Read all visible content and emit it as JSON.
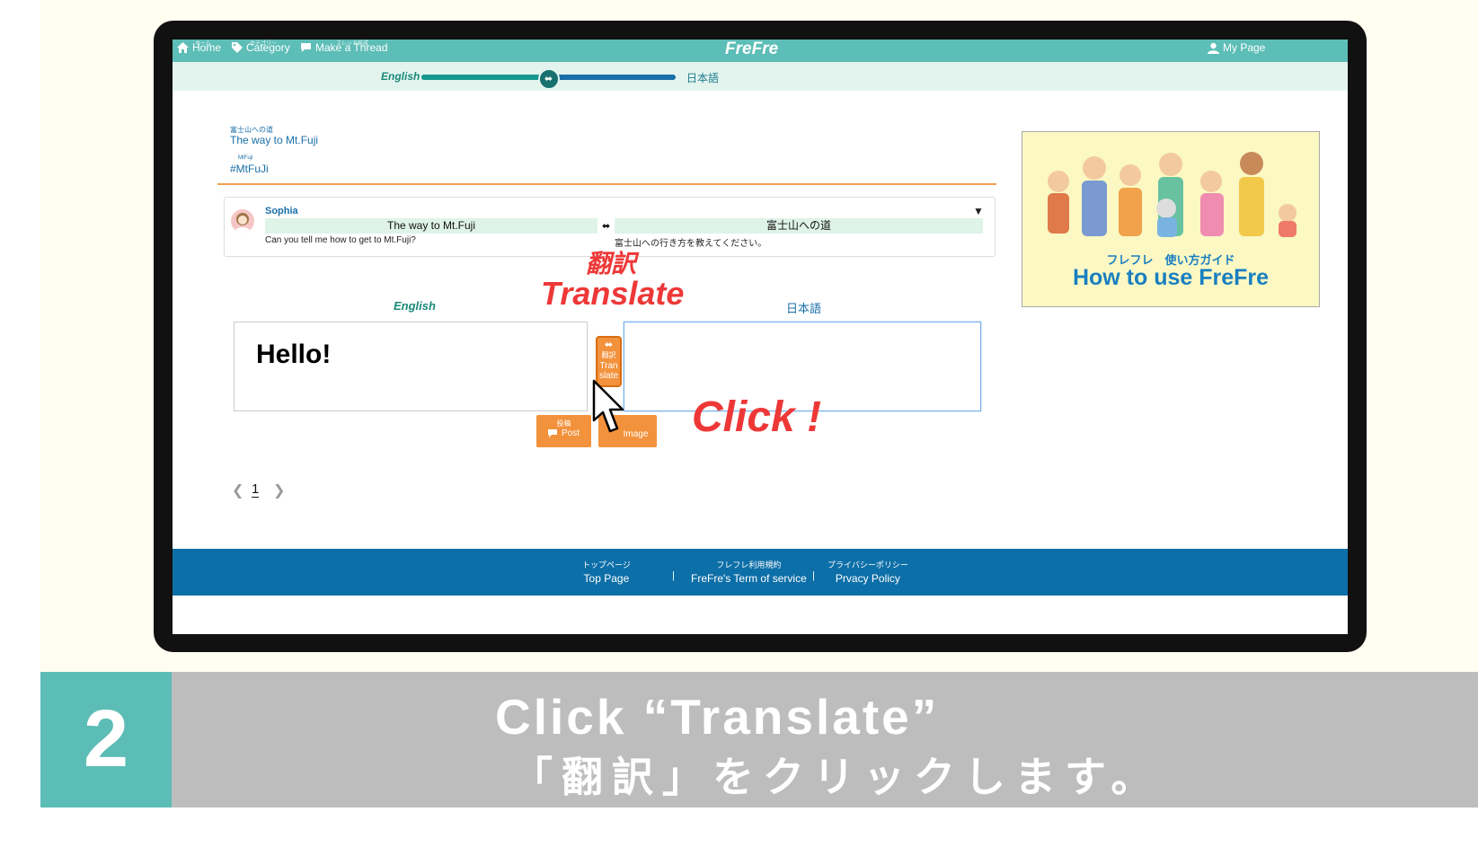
{
  "nav": {
    "home": "Home",
    "home_ruby": "ホーム",
    "category": "Category",
    "category_ruby": "カテゴリー",
    "make_thread": "Make a Thread",
    "make_thread_ruby": "スレッド作成",
    "brand": "FreFre",
    "my_page": "My Page"
  },
  "lang_bar": {
    "left": "English",
    "right": "日本語",
    "slider_value": 0.5
  },
  "thread": {
    "title_ruby": "富士山への道",
    "title": "The way to Mt.Fuji",
    "tag_ruby": "MtFuji",
    "tag": "#MtFuJi"
  },
  "post": {
    "author": "Sophia",
    "title_en": "The way to Mt.Fuji",
    "title_ja": "富士山への道",
    "body_en": "Can you tell me how to get to Mt.Fuji?",
    "body_ja": "富士山への行き方を教えてください。"
  },
  "annotation": {
    "translate_ja": "翻訳",
    "translate_en": "Translate",
    "click": "Click !"
  },
  "editor": {
    "label_en": "English",
    "label_ja": "日本語",
    "input_en_value": "Hello!",
    "input_ja_value": "",
    "translate_btn_ja": "翻訳",
    "translate_btn_en": "Tran slate",
    "post_btn_ja": "投稿",
    "post_btn_en": "Post",
    "image_btn_en": "Image"
  },
  "pager": {
    "current": "1"
  },
  "footer": {
    "top_ja": "トップページ",
    "top_en": "Top Page",
    "terms_ja": "フレフレ利用規約",
    "terms_en": "FreFre's Term of service",
    "privacy_ja": "プライバシーポリシー",
    "privacy_en": "Prvacy Policy"
  },
  "ad": {
    "title_ja": "フレフレ　使い方ガイド",
    "title_en": "How to use  FreFre"
  },
  "caption": {
    "step": "2",
    "en": "Click “Translate”",
    "ja": "「翻訳」をクリックします。"
  },
  "colors": {
    "teal": "#5dbdb7",
    "footer_blue": "#0d6fa8",
    "orange": "#f3923c",
    "annotation_red": "#ee3838"
  }
}
